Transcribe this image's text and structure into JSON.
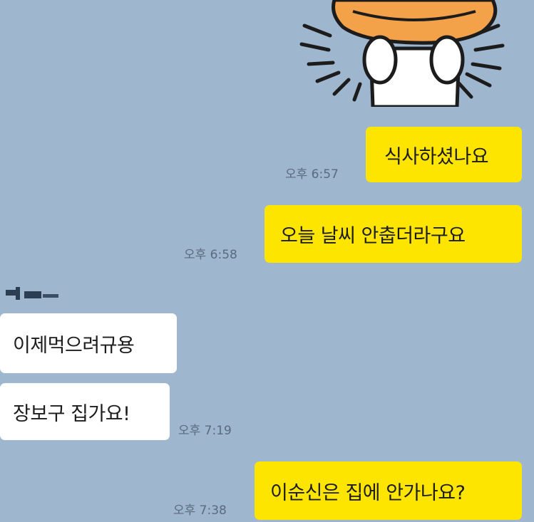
{
  "colors": {
    "background": "#9fb6cf",
    "outgoing_bubble": "#fee500",
    "incoming_bubble": "#ffffff",
    "timestamp": "#596b7d"
  },
  "sticker": {
    "icon": "character-covering-face-sticker"
  },
  "messages": [
    {
      "direction": "outgoing",
      "text": "식사하셨나요",
      "time": "오후 6:57"
    },
    {
      "direction": "outgoing",
      "text": "오늘 날씨 안춥더라구요",
      "time": "오후 6:58"
    },
    {
      "direction": "incoming",
      "text": "이제먹으려규용",
      "time": ""
    },
    {
      "direction": "incoming",
      "text": "장보구 집가요!",
      "time": "오후 7:19"
    },
    {
      "direction": "outgoing",
      "text": "이순신은 집에 안가나요?",
      "time": "오후 7:38"
    }
  ]
}
